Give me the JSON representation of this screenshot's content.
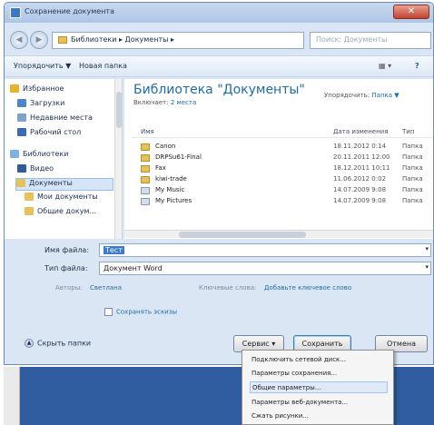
{
  "window": {
    "title": "Сохранение документа"
  },
  "nav": {
    "address": "Библиотеки ▸ Документы ▸",
    "search_placeholder": "Поиск: Документы"
  },
  "toolbar": {
    "organize": "Упорядочить ▼",
    "new_folder": "Новая папка"
  },
  "sidebar": {
    "items": [
      {
        "label": "Избранное",
        "icon": "star-icon"
      },
      {
        "label": "Загрузки",
        "icon": "downloads-icon"
      },
      {
        "label": "Недавние места",
        "icon": "recent-places-icon"
      },
      {
        "label": "Рабочий стол",
        "icon": "desktop-icon"
      },
      {
        "label": "Библиотеки",
        "icon": "libraries-icon"
      },
      {
        "label": "Видео",
        "icon": "video-icon"
      },
      {
        "label": "Документы",
        "icon": "documents-icon",
        "selected": true
      },
      {
        "label": "Мои документы",
        "icon": "folder-icon"
      },
      {
        "label": "Общие докум...",
        "icon": "folder-icon"
      }
    ]
  },
  "library": {
    "title": "Библиотека \"Документы\"",
    "includes_label": "Включает:",
    "includes_value": "2 места",
    "arrange_label": "Упорядочить:",
    "arrange_value": "Папка ▼"
  },
  "columns": {
    "name": "Имя",
    "date": "Дата изменения",
    "type": "Тип"
  },
  "files": [
    {
      "name": "Canon",
      "date": "18.11.2012 0:14",
      "type": "Папка"
    },
    {
      "name": "DRPSu61-Final",
      "date": "20.11.2011 12:00",
      "type": "Папка"
    },
    {
      "name": "Fax",
      "date": "18.12.2011 10:11",
      "type": "Папка"
    },
    {
      "name": "kiwi-trade",
      "date": "11.06.2012 0:02",
      "type": "Папка"
    },
    {
      "name": "My Music",
      "date": "14.07.2009 9:08",
      "type": "Папка"
    },
    {
      "name": "My Pictures",
      "date": "14.07.2009 9:08",
      "type": "Папка"
    }
  ],
  "form": {
    "filename_label": "Имя файла:",
    "filename_value": "Тест",
    "filetype_label": "Тип файла:",
    "filetype_value": "Документ Word",
    "authors_label": "Авторы:",
    "authors_value": "Светлана",
    "tags_label": "Ключевые слова:",
    "tags_value": "Добавьте ключевое слово",
    "thumbnail_label": "Сохранять эскизы",
    "hide_folders": "Скрыть папки",
    "service_button": "Сервис",
    "save_button": "Сохранить",
    "cancel_button": "Отмена"
  },
  "service_menu": [
    {
      "label": "Подключить сетевой диск..."
    },
    {
      "label": "Параметры сохранения..."
    },
    {
      "label": "Общие параметры...",
      "highlighted": true
    },
    {
      "label": "Параметры веб-документа..."
    },
    {
      "label": "Сжать рисунки..."
    }
  ]
}
